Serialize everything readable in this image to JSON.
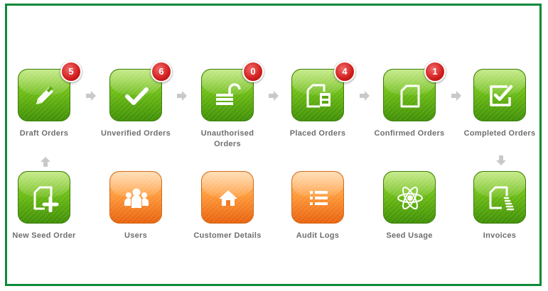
{
  "tiles": {
    "draft_orders": {
      "label": "Draft Orders",
      "count": "5",
      "color": "green",
      "icon": "pencil-icon"
    },
    "unverified_orders": {
      "label": "Unverified Orders",
      "count": "6",
      "color": "green",
      "icon": "checkmark-icon"
    },
    "unauthorised_orders": {
      "label": "Unauthorised Orders",
      "count": "0",
      "color": "green",
      "icon": "unlock-icon"
    },
    "placed_orders": {
      "label": "Placed Orders",
      "count": "4",
      "color": "green",
      "icon": "document-box-icon"
    },
    "confirmed_orders": {
      "label": "Confirmed Orders",
      "count": "1",
      "color": "green",
      "icon": "document-icon"
    },
    "completed_orders": {
      "label": "Completed Orders",
      "color": "green",
      "icon": "checkbox-icon"
    },
    "new_seed_order": {
      "label": "New Seed Order",
      "color": "green",
      "icon": "add-document-icon"
    },
    "users": {
      "label": "Users",
      "color": "orange",
      "icon": "users-icon"
    },
    "customer_details": {
      "label": "Customer Details",
      "color": "orange",
      "icon": "home-icon"
    },
    "audit_logs": {
      "label": "Audit Logs",
      "color": "orange",
      "icon": "list-icon"
    },
    "seed_usage": {
      "label": "Seed Usage",
      "color": "green",
      "icon": "atom-icon"
    },
    "invoices": {
      "label": "Invoices",
      "color": "green",
      "icon": "invoice-icon"
    }
  },
  "colors": {
    "border": "#0d8a3a",
    "green": "#6cbc14",
    "orange": "#ff9a3a",
    "badge": "#d11d1d",
    "arrow": "#c9c9c9",
    "label": "#6e6e6e"
  }
}
